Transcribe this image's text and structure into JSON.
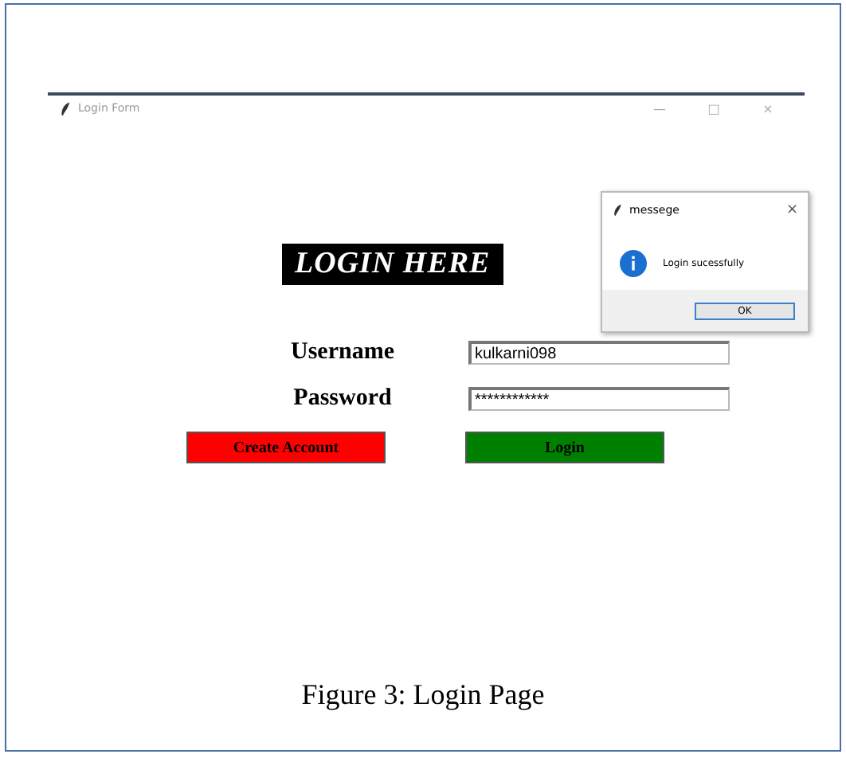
{
  "window": {
    "title": "Login Form",
    "controls": [
      "—",
      "□",
      "×"
    ]
  },
  "banner": "LOGIN HERE",
  "fields": [
    {
      "label": "Username",
      "value": "kulkarni098"
    },
    {
      "label": "Password",
      "value": "************"
    }
  ],
  "buttons": [
    {
      "label": "Create Account",
      "color": "#ff0000"
    },
    {
      "label": "Login",
      "color": "#008000"
    }
  ],
  "dialog": {
    "title": "messege",
    "close": "×",
    "message": "Login sucessfully",
    "button": "OK"
  },
  "caption": "Figure 3: Login Page"
}
